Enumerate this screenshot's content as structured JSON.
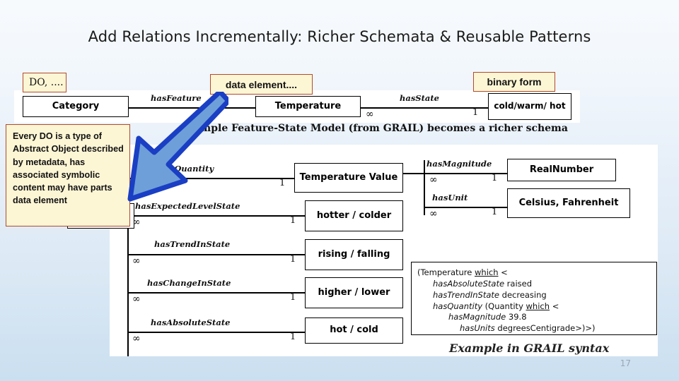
{
  "slide": {
    "title": "Add Relations Incrementally: Richer Schemata & Reusable Patterns",
    "page_number": "17",
    "caption_top": "Simple Feature-State Model (from GRAIL) becomes a richer schema",
    "caption_bottom": "Example in GRAIL syntax"
  },
  "callouts": {
    "do": "DO, ....",
    "data_element": "data element....",
    "binary_form": "binary form",
    "every_do": "Every DO is a type of Abstract Object described by metadata, has associated symbolic content may have parts  data element"
  },
  "top_diagram": {
    "nodes": [
      {
        "label": "Category"
      },
      {
        "label": "Temperature"
      },
      {
        "label": "cold/warm/ hot"
      }
    ],
    "relations": [
      {
        "name": "hasFeature",
        "source_card": "",
        "target_card": ""
      },
      {
        "name": "hasState",
        "source_card": "∞",
        "target_card": "1"
      }
    ]
  },
  "bottom_diagram": {
    "relations": [
      {
        "name": "hasQuantity",
        "source_card": "∞",
        "target_card": "1",
        "target": "Temperature Value"
      },
      {
        "name": "hasExpectedLevelState",
        "source_card": "∞",
        "target_card": "1",
        "target": "hotter / colder"
      },
      {
        "name": "hasTrendInState",
        "source_card": "∞",
        "target_card": "1",
        "target": "rising / falling"
      },
      {
        "name": "hasChangeInState",
        "source_card": "∞",
        "target_card": "1",
        "target": "higher / lower"
      },
      {
        "name": "hasAbsoluteState",
        "source_card": "∞",
        "target_card": "1",
        "target": "hot / cold"
      },
      {
        "name": "hasMagnitude",
        "source_card": "∞",
        "target_card": "1",
        "target": "RealNumber"
      },
      {
        "name": "hasUnit",
        "source_card": "∞",
        "target_card": "1",
        "target": "Celsius, Fahrenheit"
      }
    ],
    "node_labels": {
      "temperature_value": "Temperature Value",
      "hotter_colder": "hotter / colder",
      "rising_falling": "rising / falling",
      "higher_lower": "higher / lower",
      "hot_cold": "hot / cold",
      "real_number": "RealNumber",
      "celsius_fahrenheit": "Celsius, Fahrenheit"
    }
  },
  "grail_example": {
    "line1_pre": "(Temperature ",
    "line1_which": "which",
    "line1_post": " <",
    "line2_rel": "hasAbsoluteState",
    "line2_val": " raised",
    "line3_rel": "hasTrendInState",
    "line3_val": " decreasing",
    "line4_rel": "hasQuantity",
    "line4_mid": " (Quantity ",
    "line4_which": "which",
    "line4_post": " <",
    "line5_rel": "hasMagnitude",
    "line5_val": " 39.8",
    "line6_rel": "hasUnits",
    "line6_val": " degreesCentigrade>)>)"
  },
  "colors": {
    "callout_fill": "#fdf6d5",
    "callout_border": "#b4492a",
    "arrow_outline": "#1a3fc4",
    "arrow_fill": "#6f9fd8",
    "panel": "#ffffff"
  }
}
